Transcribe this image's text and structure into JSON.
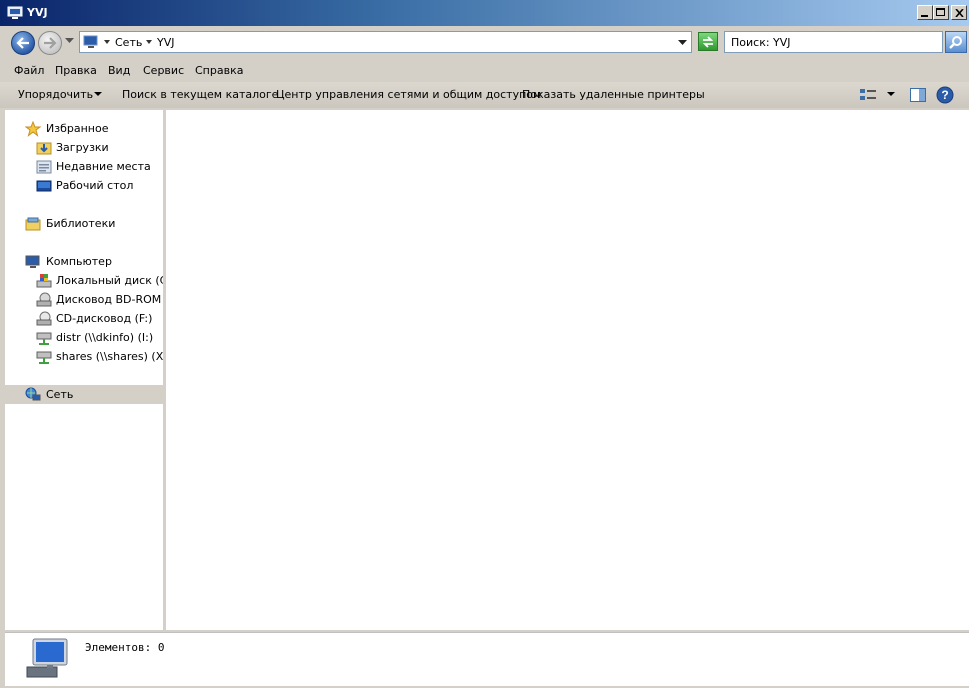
{
  "window": {
    "title": "YVJ"
  },
  "address": {
    "segments": [
      "Сеть",
      "YVJ"
    ],
    "search_placeholder": "Поиск: YVJ"
  },
  "menu": [
    "Файл",
    "Правка",
    "Вид",
    "Сервис",
    "Справка"
  ],
  "commands": {
    "organize": "Упорядочить",
    "search_here": "Поиск в текущем каталоге",
    "network_center": "Центр управления сетями и общим доступом",
    "show_printers": "Показать удаленные принтеры"
  },
  "nav": {
    "favorites": "Избранное",
    "downloads": "Загрузки",
    "recent": "Недавние места",
    "desktop": "Рабочий стол",
    "libraries": "Библиотеки",
    "computer": "Компьютер",
    "drive_c": "Локальный диск (C:)",
    "drive_bd": "Дисковод BD-ROM (E",
    "drive_cd": "CD-дисковод (F:)",
    "drive_distr": "distr (\\\\dkinfo) (I:)",
    "drive_shares": "shares (\\\\shares) (X:)",
    "network": "Сеть"
  },
  "details": {
    "items_count": "Элементов: 0"
  },
  "colors": {
    "title_start": "#0a246a",
    "title_end": "#a6caf0",
    "selection": "#d4d0c8"
  }
}
